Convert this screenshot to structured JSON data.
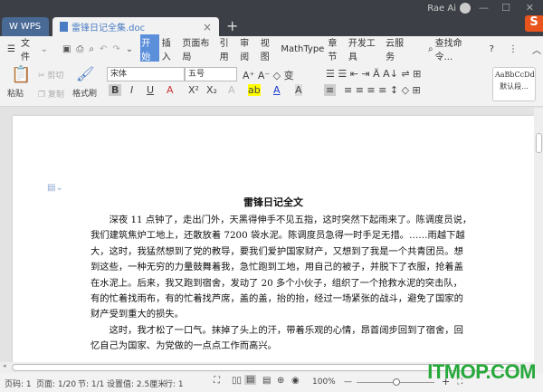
{
  "titlebar": {
    "wps_tab": "WPS",
    "doc_tab": "雷锋日记全集.doc",
    "user": "Rae Ai",
    "new_tab": "+",
    "close": "×",
    "minimize": "—",
    "maximize": "☐",
    "win_close": "✕",
    "sogou": "S"
  },
  "menu": {
    "file": "文件",
    "items": [
      "开始",
      "插入",
      "页面布局",
      "引用",
      "审阅",
      "视图",
      "MathType",
      "章节",
      "开发工具",
      "云服务"
    ],
    "search": "查找命令...",
    "help": "?"
  },
  "toolbar": {
    "paste": "粘贴",
    "cut": "剪切",
    "copy": "复制",
    "format_painter": "格式刷",
    "font": "宋体",
    "size": "五号",
    "style_preview": "AaBbCcDd",
    "style_name": "默认段..."
  },
  "document": {
    "title": "雷锋日记全文",
    "lines": [
      "　　深夜 11 点钟了，走出门外，天黑得伸手不见五指，这时突然下起雨来了。陈调度员说，",
      "我们建筑焦炉工地上，还散放着 7200 袋水泥。陈调度员急得一时手足无措。……雨越下越",
      "大，这时，我猛然想到了党的教导，要我们爱护国家财产，又想到了我是一个共青团员。想",
      "到这些，一种无穷的力量鼓舞着我，急忙跑到工地，用自己的被子，并脱下了衣服，抢着盖",
      "在水泥上。后来，我又跑到宿舍，发动了 20 多个小伙子，组织了一个抢救水泥的突击队，",
      "有的忙着找雨布，有的忙着找芦席，盖的盖，抬的抬，经过一场紧张的战斗，避免了国家的",
      "财产受到重大的损失。",
      "　　这时，我才松了一口气。抹掉了头上的汗，带着乐观的心情，昂首阔步回到了宿舍，回",
      "忆自己为国家、为党做的一点点工作而高兴。"
    ]
  },
  "status": {
    "page_no": "页码: 1",
    "pages": "页面: 1/20",
    "section": "节: 1/1",
    "setting": "设置值: 2.5厘米",
    "row": "行: 1",
    "zoom": "100%",
    "zoom_level": 100
  },
  "watermark": "ITMOP.COM"
}
